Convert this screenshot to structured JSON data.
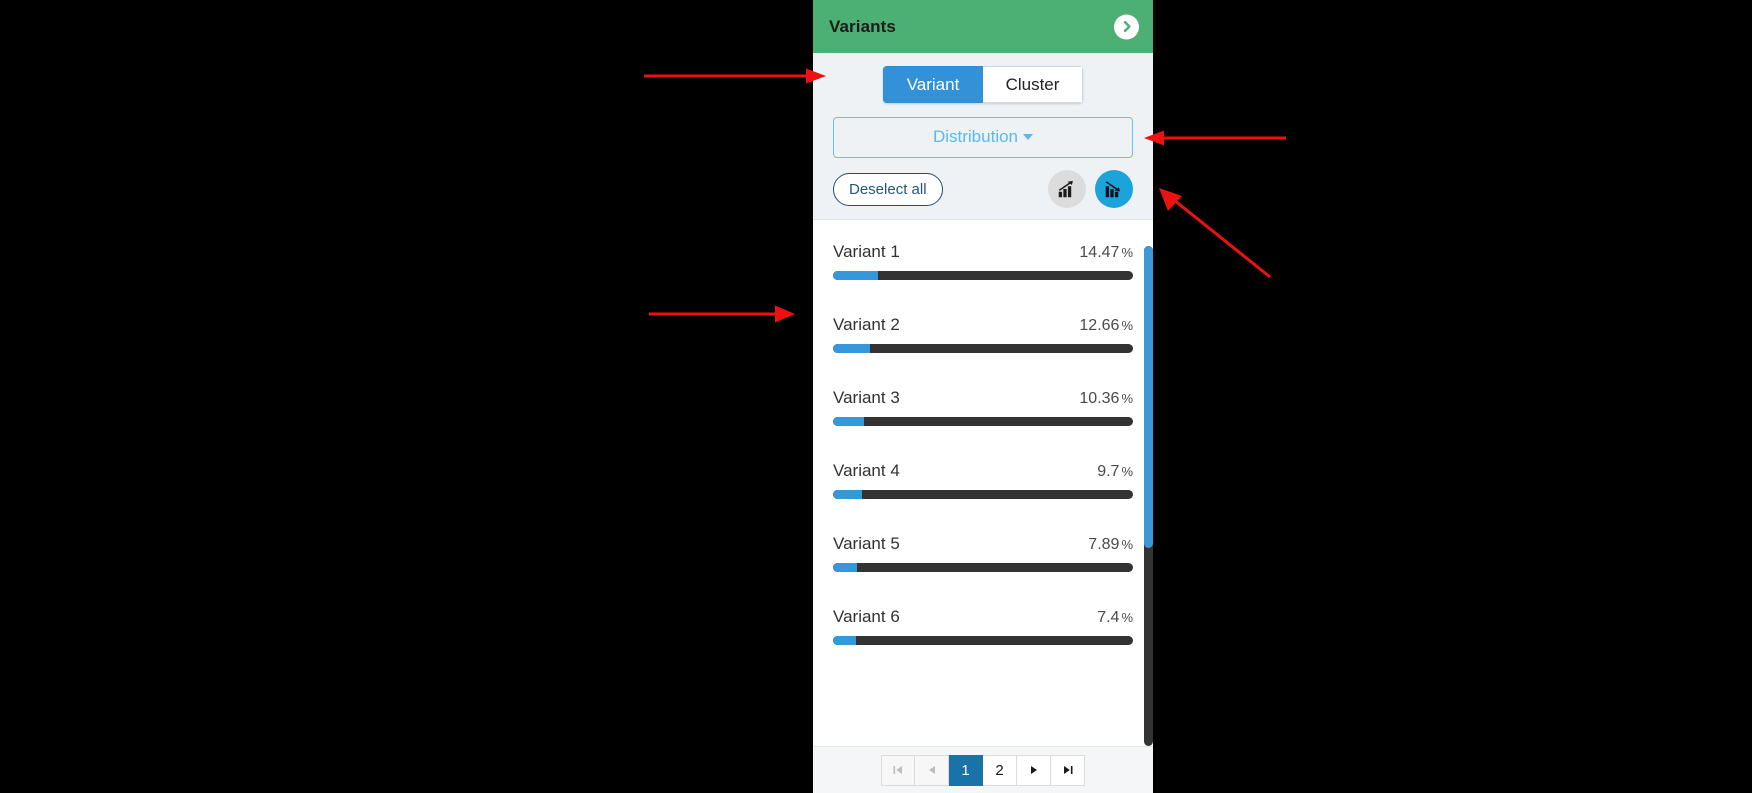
{
  "panel": {
    "title": "Variants",
    "collapse_icon": "chevron-right-circle-icon",
    "header_color": "#4caf74"
  },
  "toolbar": {
    "segmented": {
      "options": [
        "Variant",
        "Cluster"
      ],
      "selected": "Variant",
      "active_color": "#3391d8"
    },
    "dropdown": {
      "label": "Distribution",
      "caret_icon": "caret-down-icon",
      "border_color": "#68c0ef",
      "text_color": "#5bb8ed"
    },
    "deselect_label": "Deselect all",
    "sort_buttons": [
      {
        "name": "sort-ascending-icon",
        "active": false,
        "bg": "#dcdcdc"
      },
      {
        "name": "sort-descending-icon",
        "active": true,
        "bg": "#1ba3da"
      }
    ]
  },
  "chart_data": {
    "type": "bar",
    "title": "Variants",
    "xlabel": "",
    "ylabel": "",
    "unit": "%",
    "categories": [
      "Variant 1",
      "Variant 2",
      "Variant 3",
      "Variant 4",
      "Variant 5",
      "Variant 6"
    ],
    "values": [
      14.47,
      12.66,
      10.36,
      9.7,
      7.89,
      7.4
    ],
    "value_labels": [
      "14.47",
      "12.66",
      "10.36",
      "9.7",
      "7.89",
      "7.4"
    ],
    "xlim": [
      0,
      100
    ],
    "grid": false,
    "legend": "none",
    "bar_color": "#3498db",
    "track_color": "#333333"
  },
  "list": {
    "rows": [
      {
        "label": "Variant 1",
        "value": "14.47",
        "unit": "%",
        "fill_pct": 15.1
      },
      {
        "label": "Variant 2",
        "value": "12.66",
        "unit": "%",
        "fill_pct": 12.3
      },
      {
        "label": "Variant 3",
        "value": "10.36",
        "unit": "%",
        "fill_pct": 10.2
      },
      {
        "label": "Variant 4",
        "value": "9.7",
        "unit": "%",
        "fill_pct": 9.8
      },
      {
        "label": "Variant 5",
        "value": "7.89",
        "unit": "%",
        "fill_pct": 8.1
      },
      {
        "label": "Variant 6",
        "value": "7.4",
        "unit": "%",
        "fill_pct": 7.7
      }
    ]
  },
  "scrollbar": {
    "thumb_color": "#3e98d8",
    "track_color": "#333333"
  },
  "pagination": {
    "first_icon": "page-first-icon",
    "prev_icon": "page-prev-icon",
    "pages": [
      "1",
      "2"
    ],
    "current_page": "1",
    "next_icon": "page-next-icon",
    "last_icon": "page-last-icon",
    "active_color": "#1874a8"
  },
  "annotations": {
    "color": "#ee1111",
    "arrows": [
      {
        "name": "annotation-arrow-to-variant-tab",
        "direction": "right"
      },
      {
        "name": "annotation-arrow-to-distribution",
        "direction": "left"
      },
      {
        "name": "annotation-arrow-to-sort-descending",
        "direction": "up-left"
      },
      {
        "name": "annotation-arrow-to-variant-list",
        "direction": "right"
      }
    ]
  }
}
